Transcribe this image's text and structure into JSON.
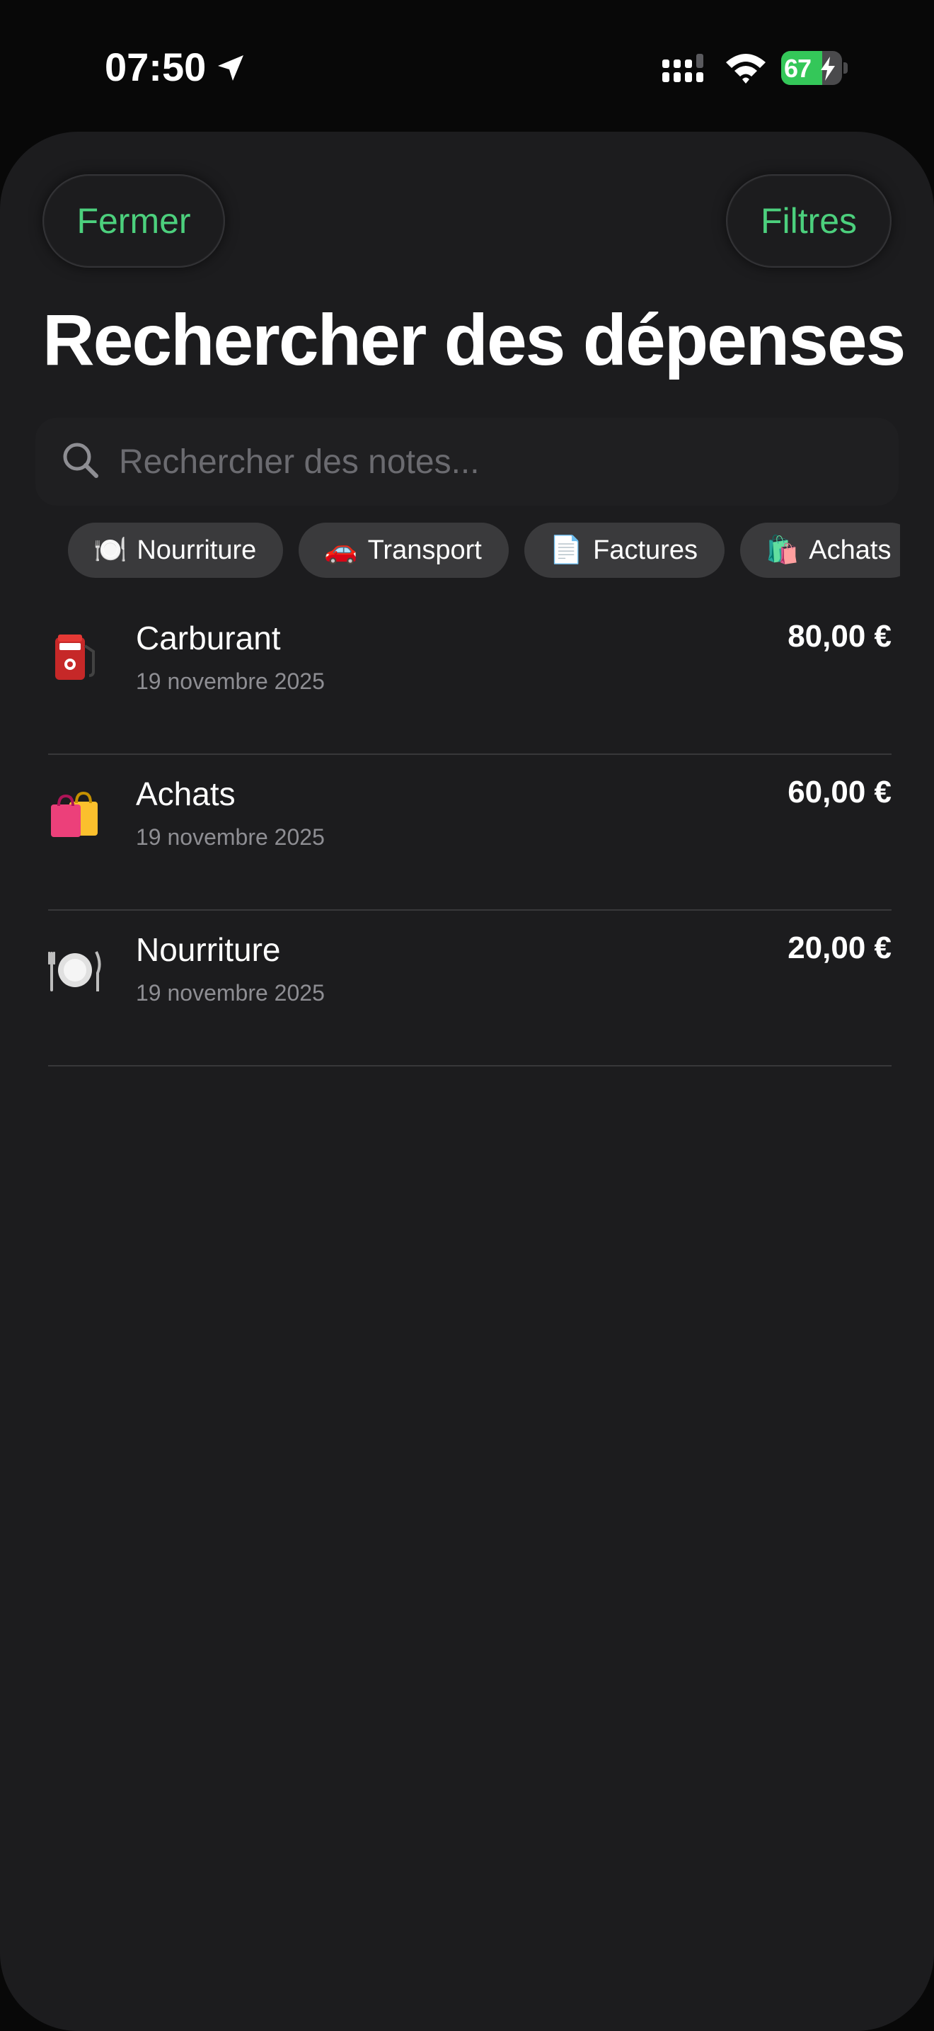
{
  "status_bar": {
    "time": "07:50",
    "battery_level": "67",
    "battery_fraction": 0.67,
    "icons": [
      "location-arrow-icon",
      "cellular-signal-icon",
      "wifi-icon",
      "battery-charging-icon"
    ]
  },
  "header": {
    "close_label": "Fermer",
    "filters_label": "Filtres",
    "title": "Rechercher des dépenses"
  },
  "search": {
    "placeholder": "Rechercher des notes...",
    "value": "",
    "icon": "search-icon"
  },
  "chips": [
    {
      "emoji": "🍽️",
      "label": "Nourriture",
      "icon": "plate-icon"
    },
    {
      "emoji": "🚗",
      "label": "Transport",
      "icon": "car-icon"
    },
    {
      "emoji": "📄",
      "label": "Factures",
      "icon": "document-icon"
    },
    {
      "emoji": "🛍️",
      "label": "Achats",
      "icon": "shopping-bags-icon"
    }
  ],
  "expenses": [
    {
      "name": "Carburant",
      "date": "19 novembre 2025",
      "amount": "80,00 €",
      "icon": "fuel-pump-icon"
    },
    {
      "name": "Achats",
      "date": "19 novembre 2025",
      "amount": "60,00 €",
      "icon": "shopping-bags-icon"
    },
    {
      "name": "Nourriture",
      "date": "19 novembre 2025",
      "amount": "20,00 €",
      "icon": "plate-icon"
    }
  ],
  "colors": {
    "accent": "#4cd07d",
    "background": "#1c1c1e",
    "chip_background": "#3a3a3c",
    "battery_green": "#34c759",
    "secondary_text": "#8e8e93"
  }
}
